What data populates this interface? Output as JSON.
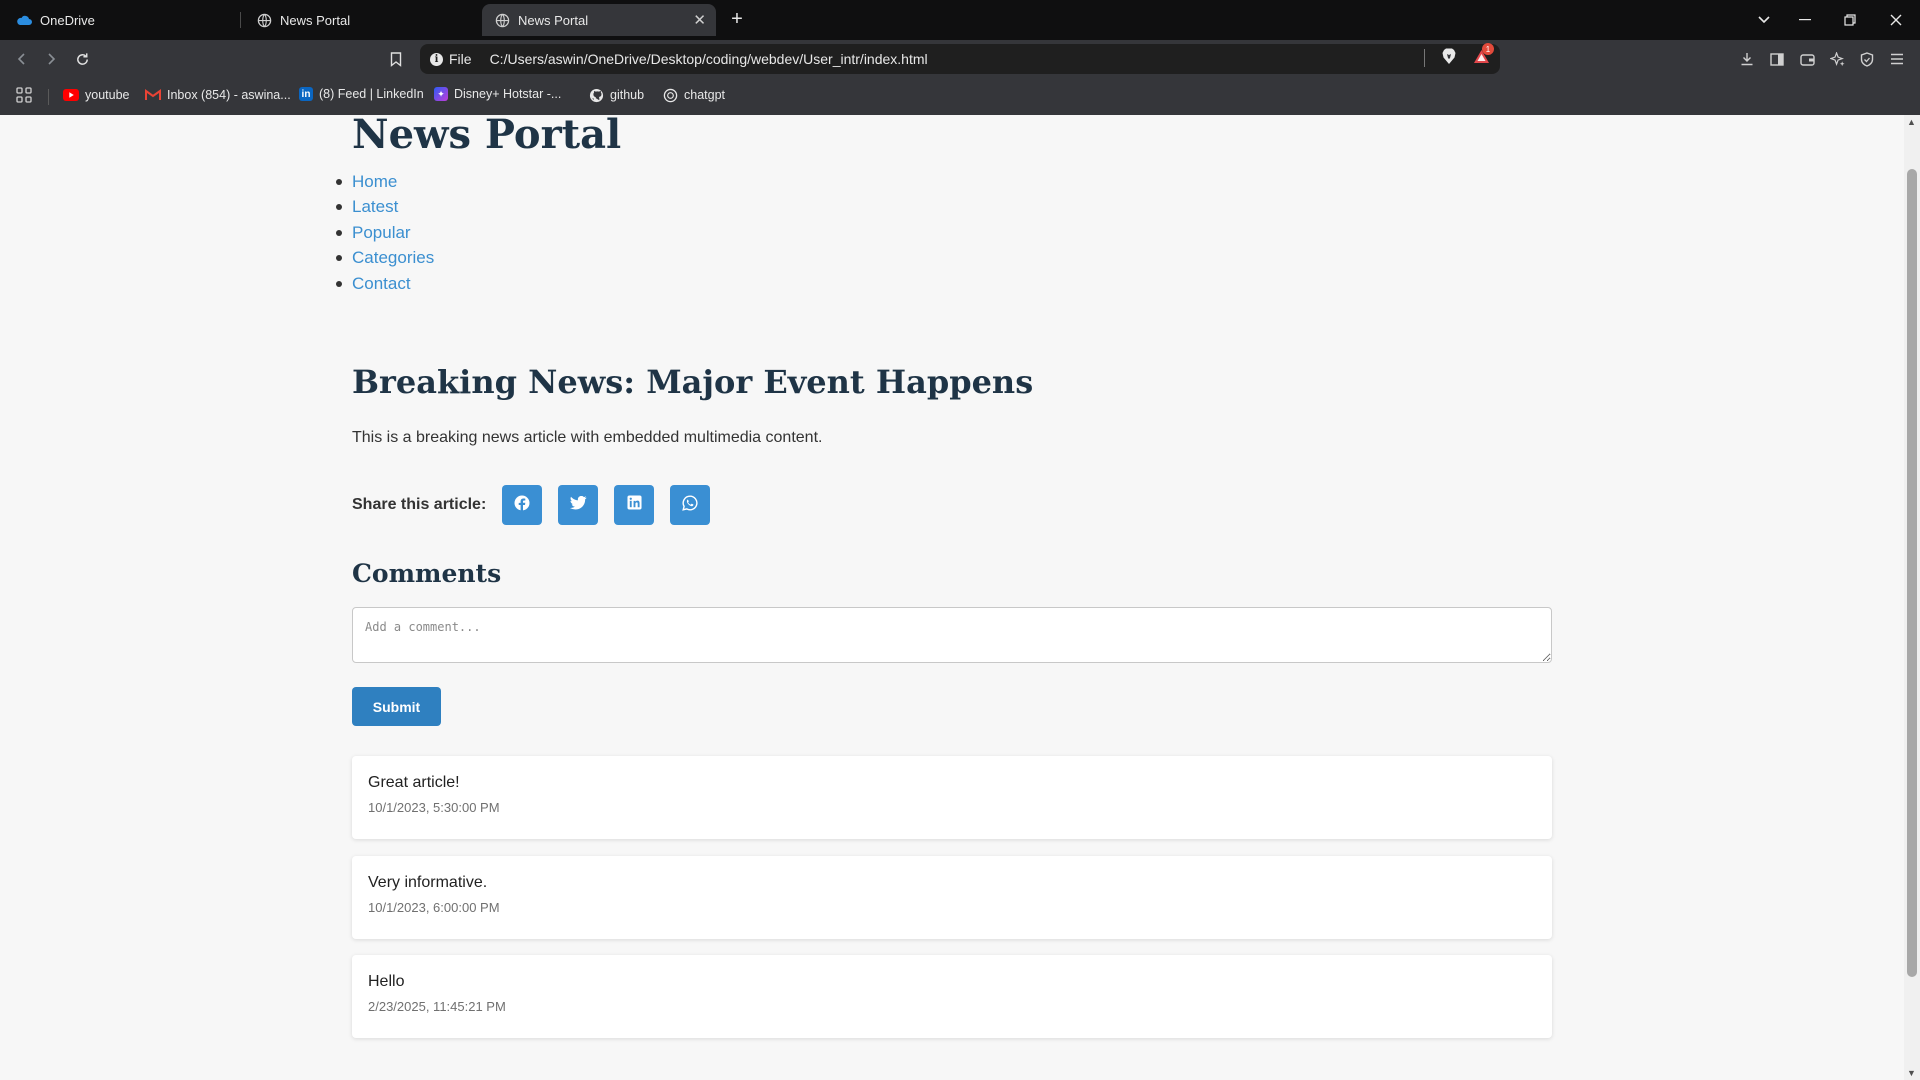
{
  "browser": {
    "tabs": [
      {
        "label": "OneDrive",
        "icon": "onedrive-icon",
        "active": false
      },
      {
        "label": "News Portal",
        "icon": "globe-icon",
        "active": false
      },
      {
        "label": "News Portal",
        "icon": "globe-icon",
        "active": true
      }
    ],
    "url_scheme": "File",
    "url": "C:/Users/aswin/OneDrive/Desktop/coding/webdev/User_intr/index.html",
    "notification_count": "1",
    "bookmarks": [
      {
        "label": "youtube",
        "icon": "youtube-icon"
      },
      {
        "label": "Inbox (854) - aswina...",
        "icon": "gmail-icon"
      },
      {
        "label": "(8) Feed | LinkedIn",
        "icon": "linkedin-icon"
      },
      {
        "label": "Disney+ Hotstar -...",
        "icon": "hotstar-icon"
      },
      {
        "label": "github",
        "icon": "github-icon"
      },
      {
        "label": "chatgpt",
        "icon": "chatgpt-icon"
      }
    ]
  },
  "page": {
    "site_title": "News Portal",
    "nav": [
      "Home",
      "Latest",
      "Popular",
      "Categories",
      "Contact"
    ],
    "article": {
      "title": "Breaking News: Major Event Happens",
      "body": "This is a breaking news article with embedded multimedia content."
    },
    "share": {
      "label": "Share this article:",
      "buttons": [
        "facebook-icon",
        "twitter-icon",
        "linkedin-icon",
        "whatsapp-icon"
      ]
    },
    "comments": {
      "title": "Comments",
      "placeholder": "Add a comment...",
      "submit_label": "Submit",
      "items": [
        {
          "text": "Great article!",
          "time": "10/1/2023, 5:30:00 PM"
        },
        {
          "text": "Very informative.",
          "time": "10/1/2023, 6:00:00 PM"
        },
        {
          "text": "Hello",
          "time": "2/23/2025, 11:45:21 PM"
        }
      ]
    }
  },
  "colors": {
    "heading": "#1f3446",
    "link": "#3b8fd0",
    "share_button": "#3a8fd3",
    "submit_button": "#2f80c0",
    "page_bg": "#f7f7f7"
  }
}
